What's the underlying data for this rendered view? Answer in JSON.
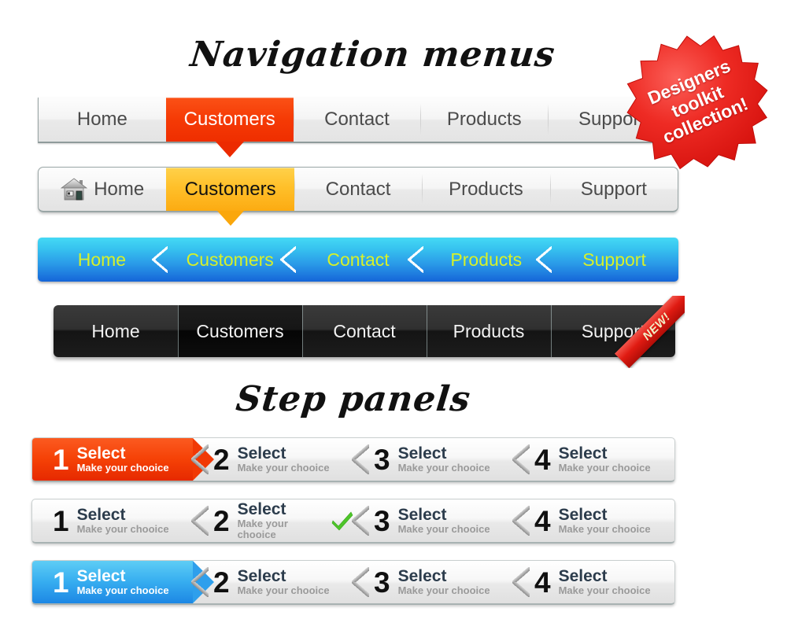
{
  "titles": {
    "navigation": "Navigation menus",
    "steps": "Step panels"
  },
  "badge": {
    "line1": "Designers",
    "line2": "toolkit",
    "line3": "collection!",
    "color": "#ee2420"
  },
  "nav_bars": [
    {
      "name": "light-red-bar",
      "accent": "#f53a05",
      "items": [
        {
          "label": "Home",
          "active": false
        },
        {
          "label": "Customers",
          "active": true
        },
        {
          "label": "Contact",
          "active": false
        },
        {
          "label": "Products",
          "active": false
        },
        {
          "label": "Support",
          "active": false
        }
      ]
    },
    {
      "name": "light-orange-bar",
      "accent": "#ffc02a",
      "items": [
        {
          "label": "Home",
          "active": false,
          "icon": "home-icon"
        },
        {
          "label": "Customers",
          "active": true
        },
        {
          "label": "Contact",
          "active": false
        },
        {
          "label": "Products",
          "active": false
        },
        {
          "label": "Support",
          "active": false
        }
      ]
    },
    {
      "name": "blue-arrow-bar",
      "accent": "#2a9ae8",
      "text_color": "#d6f12a",
      "items": [
        {
          "label": "Home",
          "active": false
        },
        {
          "label": "Customers",
          "active": false
        },
        {
          "label": "Contact",
          "active": false
        },
        {
          "label": "Products",
          "active": false
        },
        {
          "label": "Support",
          "active": false
        }
      ]
    },
    {
      "name": "dark-bar",
      "accent": "#141414",
      "ribbon": "NEW!",
      "items": [
        {
          "label": "Home",
          "active": false
        },
        {
          "label": "Customers",
          "active": true
        },
        {
          "label": "Contact",
          "active": false
        },
        {
          "label": "Products",
          "active": false
        },
        {
          "label": "Support",
          "active": false
        }
      ]
    }
  ],
  "step_panels": [
    {
      "name": "steps-red",
      "highlight": "red",
      "steps": [
        {
          "num": "1",
          "label": "Select",
          "sub": "Make your chooice",
          "check": false
        },
        {
          "num": "2",
          "label": "Select",
          "sub": "Make your chooice",
          "check": false
        },
        {
          "num": "3",
          "label": "Select",
          "sub": "Make your chooice",
          "check": false
        },
        {
          "num": "4",
          "label": "Select",
          "sub": "Make your chooice",
          "check": false
        }
      ]
    },
    {
      "name": "steps-plain",
      "highlight": "none",
      "steps": [
        {
          "num": "1",
          "label": "Select",
          "sub": "Make your chooice",
          "check": false
        },
        {
          "num": "2",
          "label": "Select",
          "sub": "Make your chooice",
          "check": true
        },
        {
          "num": "3",
          "label": "Select",
          "sub": "Make your chooice",
          "check": false
        },
        {
          "num": "4",
          "label": "Select",
          "sub": "Make your chooice",
          "check": false
        }
      ]
    },
    {
      "name": "steps-blue",
      "highlight": "blue",
      "steps": [
        {
          "num": "1",
          "label": "Select",
          "sub": "Make your chooice",
          "check": false
        },
        {
          "num": "2",
          "label": "Select",
          "sub": "Make your chooice",
          "check": false
        },
        {
          "num": "3",
          "label": "Select",
          "sub": "Make your chooice",
          "check": false
        },
        {
          "num": "4",
          "label": "Select",
          "sub": "Make your chooice",
          "check": false
        }
      ]
    }
  ]
}
